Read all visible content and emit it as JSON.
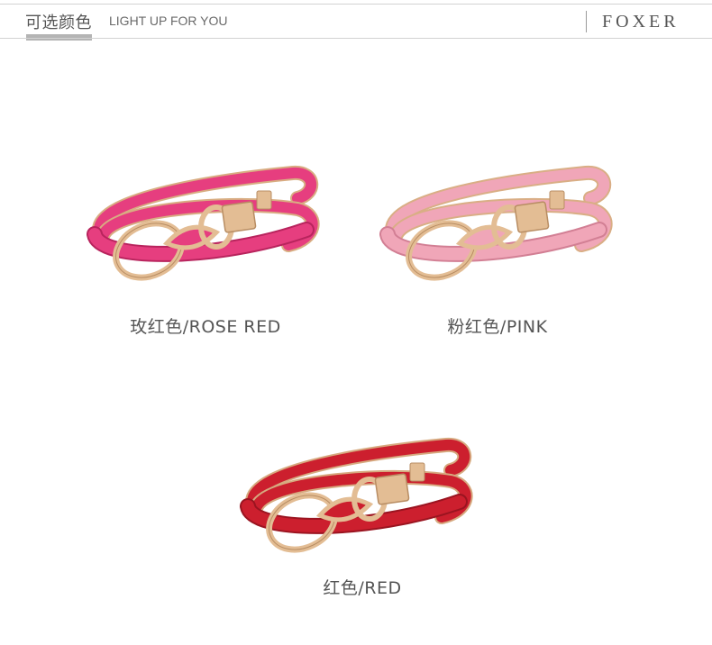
{
  "header": {
    "title_cn": "可选颜色",
    "title_en": "LIGHT UP FOR YOU",
    "brand": "FOXER"
  },
  "products": [
    {
      "label": "玫红色/ROSE RED",
      "color": "#e63e7f",
      "dark": "#b8245d",
      "inner": "#d8ad82"
    },
    {
      "label": "粉红色/PINK",
      "color": "#f0a6b8",
      "dark": "#d27f94",
      "inner": "#d9ae85"
    },
    {
      "label": "红色/RED",
      "color": "#cc1f2e",
      "dark": "#9a1420",
      "inner": "#d6a97f"
    }
  ],
  "colors": {
    "gold": "#e3bd94",
    "gold_dark": "#b88d63",
    "rule": "#d2d2d2",
    "underline": "#b4b4b4"
  }
}
